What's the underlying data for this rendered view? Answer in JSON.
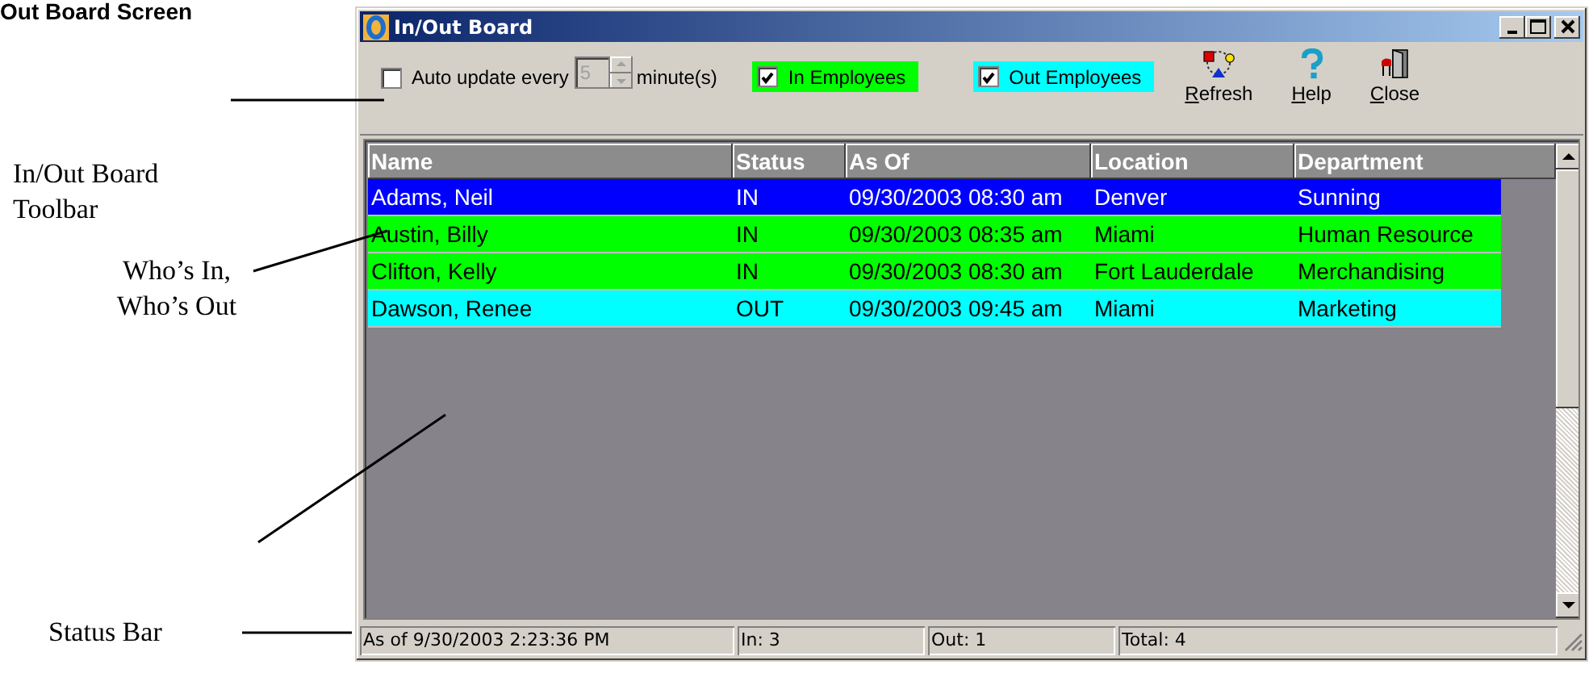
{
  "page_heading": "Out Board Screen",
  "callouts": [
    {
      "text": "In/Out Board Toolbar"
    },
    {
      "text": "Who’s In, Who’s Out"
    },
    {
      "text": "Status Bar"
    }
  ],
  "window": {
    "title": "In/Out Board"
  },
  "toolbar": {
    "auto_update": {
      "label": "Auto update every",
      "checked": false,
      "value": "5",
      "disabled": true,
      "unit": "minute(s)"
    },
    "filters": [
      {
        "label": "In Employees",
        "checked": true,
        "color": "#00ff00"
      },
      {
        "label": "Out Employees",
        "checked": true,
        "color": "#00ffff"
      }
    ],
    "buttons": [
      {
        "label": "Refresh",
        "kind": "refresh"
      },
      {
        "label": "Help",
        "kind": "help"
      },
      {
        "label": "Close",
        "kind": "close"
      }
    ]
  },
  "grid": {
    "columns": [
      "Name",
      "Status",
      "As Of",
      "Location",
      "Department"
    ],
    "rows": [
      {
        "cells": [
          "Adams, Neil",
          "IN",
          "09/30/2003 08:30 am",
          "Denver",
          "Sunning"
        ],
        "color": "#0000ff"
      },
      {
        "cells": [
          "Austin, Billy",
          "IN",
          "09/30/2003 08:35 am",
          "Miami",
          "Human Resource"
        ],
        "color": "#00ff00"
      },
      {
        "cells": [
          "Clifton, Kelly",
          "IN",
          "09/30/2003 08:30 am",
          "Fort Lauderdale",
          "Merchandising"
        ],
        "color": "#00ff00"
      },
      {
        "cells": [
          "Dawson, Renee",
          "OUT",
          "09/30/2003 09:45 am",
          "Miami",
          "Marketing"
        ],
        "color": "#00ffff"
      }
    ]
  },
  "status_bar": [
    "As of 9/30/2003 2:23:36 PM",
    "In: 3",
    "Out: 1",
    "Total: 4"
  ]
}
